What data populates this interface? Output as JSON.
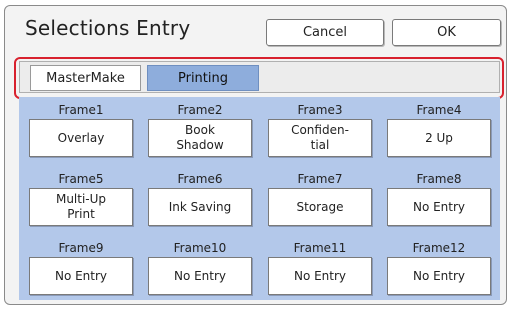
{
  "dialog": {
    "title": "Selections Entry",
    "cancel_label": "Cancel",
    "ok_label": "OK"
  },
  "tabs": [
    {
      "label": "MasterMake",
      "selected": false
    },
    {
      "label": "Printing",
      "selected": true
    }
  ],
  "frames": [
    {
      "label": "Frame1",
      "value": "Overlay"
    },
    {
      "label": "Frame2",
      "value": "Book\nShadow"
    },
    {
      "label": "Frame3",
      "value": "Confiden-\ntial"
    },
    {
      "label": "Frame4",
      "value": "2 Up"
    },
    {
      "label": "Frame5",
      "value": "Multi-Up\nPrint"
    },
    {
      "label": "Frame6",
      "value": "Ink Saving"
    },
    {
      "label": "Frame7",
      "value": "Storage"
    },
    {
      "label": "Frame8",
      "value": "No Entry"
    },
    {
      "label": "Frame9",
      "value": "No Entry"
    },
    {
      "label": "Frame10",
      "value": "No Entry"
    },
    {
      "label": "Frame11",
      "value": "No Entry"
    },
    {
      "label": "Frame12",
      "value": "No Entry"
    }
  ],
  "colors": {
    "grid_background": "#b3c8ea",
    "selected_tab": "#8eaddc",
    "highlight": "#d8212e"
  }
}
